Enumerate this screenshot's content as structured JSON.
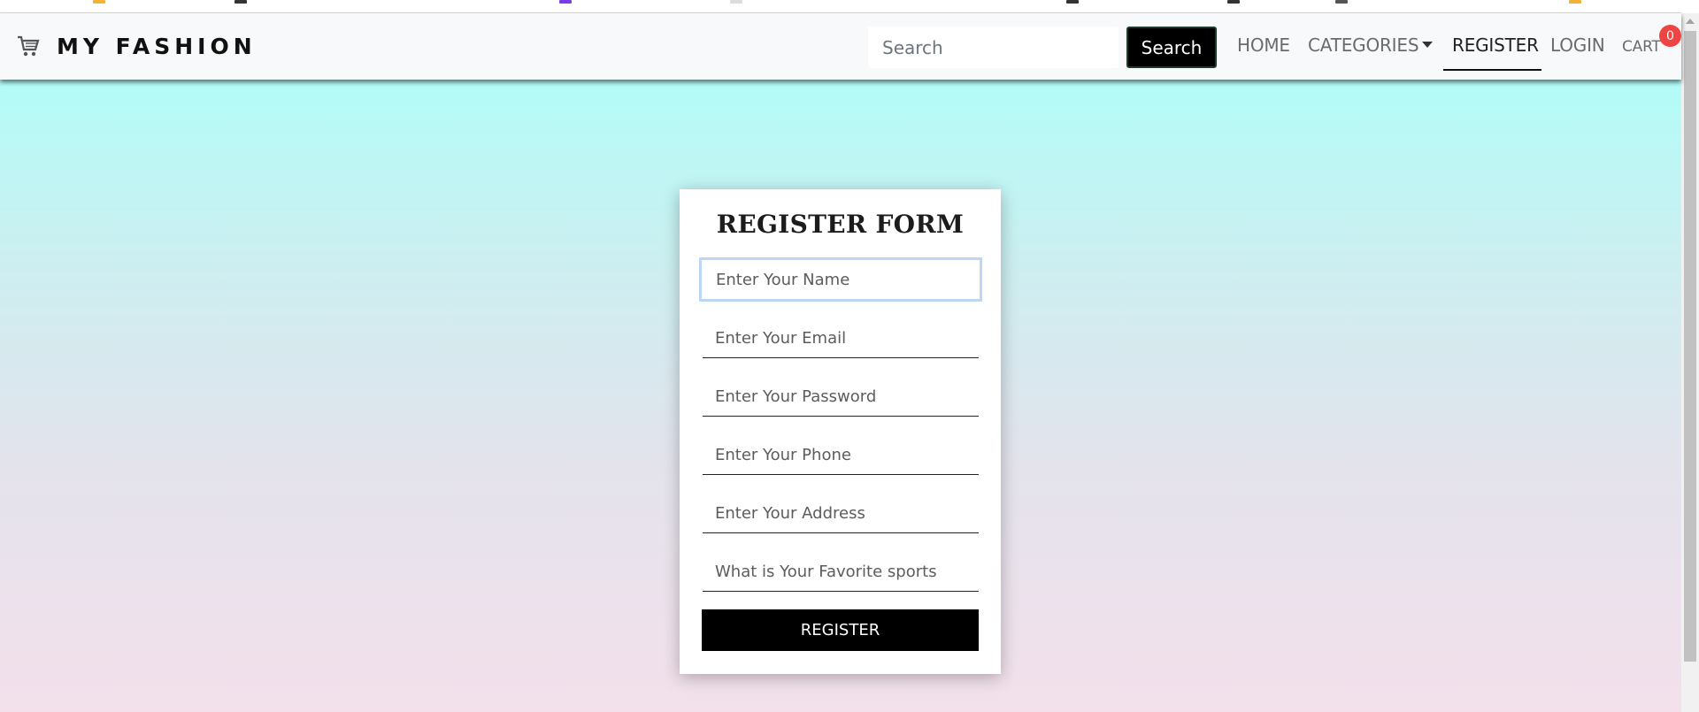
{
  "brand": {
    "name": "MY FASHION",
    "logo_icon": "cart-icon"
  },
  "search": {
    "placeholder": "Search",
    "button_label": "Search"
  },
  "nav": {
    "home": "HOME",
    "categories": "CATEGORIES",
    "register": "REGISTER",
    "login": "LOGIN",
    "cart": "CART",
    "cart_count": "0",
    "active": "REGISTER"
  },
  "form": {
    "title": "REGISTER FORM",
    "fields": {
      "name": {
        "placeholder": "Enter Your Name"
      },
      "email": {
        "placeholder": "Enter Your Email"
      },
      "password": {
        "placeholder": "Enter Your Password"
      },
      "phone": {
        "placeholder": "Enter Your Phone"
      },
      "address": {
        "placeholder": "Enter Your Address"
      },
      "sports": {
        "placeholder": "What is Your Favorite sports"
      }
    },
    "submit_label": "REGISTER"
  },
  "colors": {
    "gradient_top": "#b2fcf8",
    "gradient_bottom": "#f3e0eb",
    "badge": "#ef4444",
    "button": "#000000",
    "focus_ring": "#bdd6f6"
  }
}
